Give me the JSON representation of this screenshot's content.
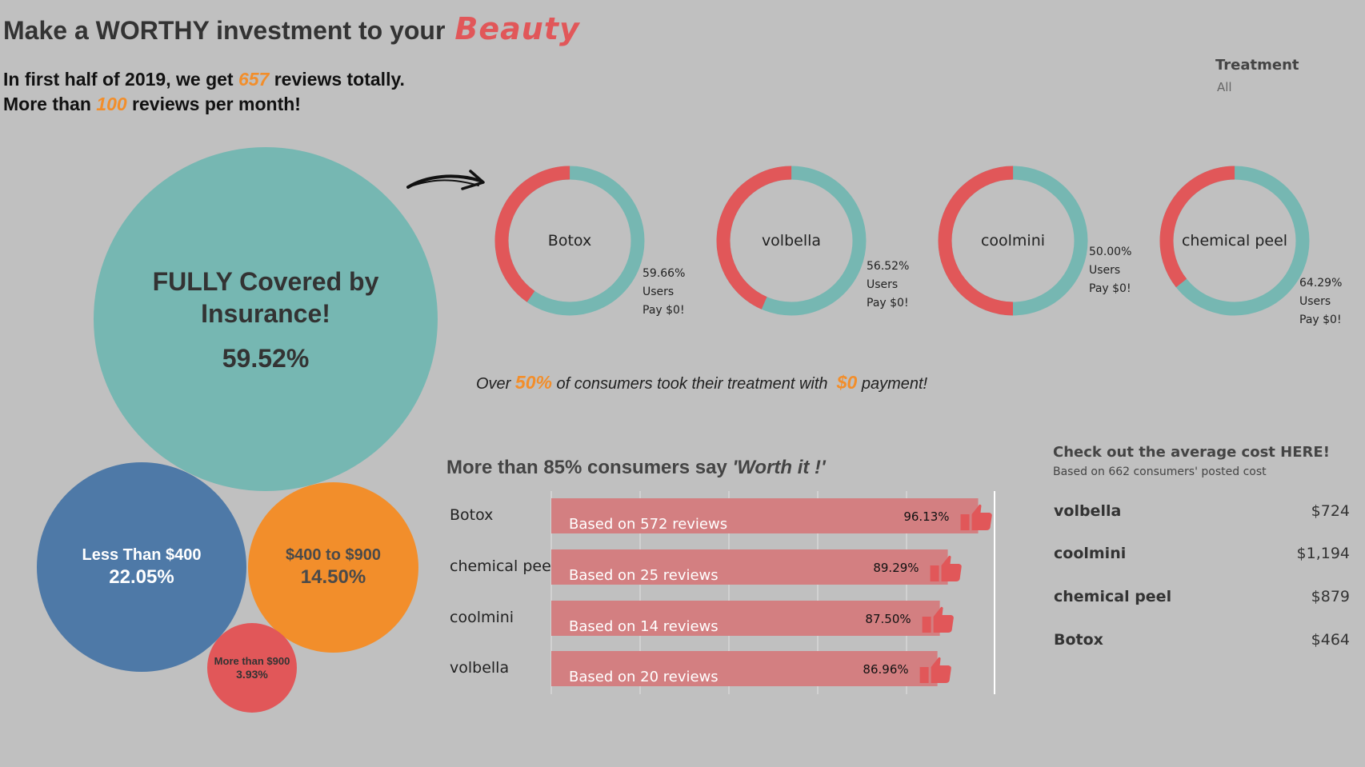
{
  "header": {
    "title_main": "Make a WORTHY investment to your",
    "title_accent": "Beauty",
    "line1_pre": "In first half of 2019, we get",
    "line1_num": "657",
    "line1_post": "reviews totally.",
    "line2_pre": "More than",
    "line2_num": "100",
    "line2_post": "reviews per month!"
  },
  "filter": {
    "title": "Treatment",
    "value": "All"
  },
  "colors": {
    "teal": "#76b7b2",
    "red": "#e15759",
    "blue": "#4e79a7",
    "orange": "#f28e2b",
    "bar": "#d37f81",
    "background": "#c0c0c0"
  },
  "bubbles": {
    "full": {
      "label": "FULLY Covered by Insurance!",
      "value": "59.52%"
    },
    "less": {
      "label": "Less Than $400",
      "value": "22.05%"
    },
    "mid": {
      "label": "$400 to $900",
      "value": "14.50%"
    },
    "more": {
      "label": "More than $900",
      "value": "3.93%"
    }
  },
  "statement": {
    "pre": "Over",
    "pct": "50%",
    "mid": "of consumers took their treatment with",
    "amount": "$0",
    "post": "payment!"
  },
  "chart_data": [
    {
      "type": "pie",
      "title": "",
      "series": [
        {
          "name": "Botox",
          "pct_label": "59.66%",
          "values": [
            59.66,
            40.34
          ]
        },
        {
          "name": "volbella",
          "pct_label": "56.52%",
          "values": [
            56.52,
            43.48
          ]
        },
        {
          "name": "coolmini",
          "pct_label": "50.00%",
          "values": [
            50.0,
            50.0
          ]
        },
        {
          "name": "chemical peel",
          "pct_label": "64.29%",
          "values": [
            64.29,
            35.71
          ]
        }
      ],
      "note_line1": "Users",
      "note_line2": "Pay $0!"
    },
    {
      "type": "bar",
      "title_pre": "More than 85% consumers say",
      "title_quote": "'Worth it !'",
      "categories": [
        "Botox",
        "chemical peel",
        "coolmini",
        "volbella"
      ],
      "values": [
        96.13,
        89.29,
        87.5,
        86.96
      ],
      "value_labels": [
        "96.13%",
        "89.29%",
        "87.50%",
        "86.96%"
      ],
      "review_labels": [
        "Based on 572 reviews",
        "Based on 25 reviews",
        "Based on 14 reviews",
        "Based on 20 reviews"
      ],
      "xlim": [
        0,
        100
      ]
    },
    {
      "type": "table",
      "title": "Check out the average cost HERE!",
      "subtitle": "Based on 662 consumers' posted cost",
      "rows": [
        {
          "name": "volbella",
          "cost": "$724"
        },
        {
          "name": "coolmini",
          "cost": "$1,194"
        },
        {
          "name": "chemical peel",
          "cost": "$879"
        },
        {
          "name": "Botox",
          "cost": "$464"
        }
      ]
    }
  ]
}
